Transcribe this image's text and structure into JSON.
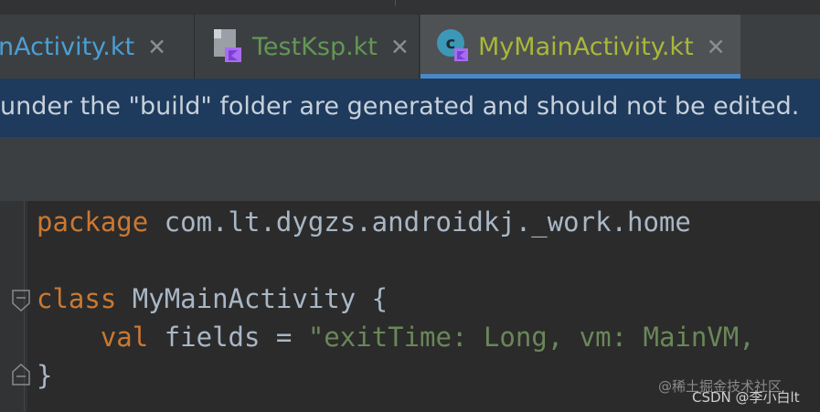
{
  "tabs": [
    {
      "label": "ainActivity.kt",
      "icon": "kotlin-file-icon"
    },
    {
      "label": "TestKsp.kt",
      "icon": "kotlin-script-file-icon"
    },
    {
      "label": "MyMainActivity.kt",
      "icon": "kotlin-class-icon",
      "active": true
    }
  ],
  "close_glyph": "✕",
  "banner": {
    "text": "under the \"build\" folder are generated and should not be edited."
  },
  "code": {
    "line1": {
      "keyword": "package",
      "rest": " com.lt.dygzs.androidkj._work.home"
    },
    "line3": {
      "keyword": "class",
      "rest": " MyMainActivity {"
    },
    "line4": {
      "indent": "    ",
      "keyword": "val",
      "rest": " fields = ",
      "string": "\"exitTime: Long, vm: MainVM,"
    },
    "line5": {
      "text": "}"
    }
  },
  "watermark": {
    "line1": "@稀土掘金技术社区",
    "line2": "CSDN @李小白lt"
  },
  "colors": {
    "keyword": "#cc7832",
    "string": "#6a8759",
    "text": "#a9b7c6",
    "banner_bg": "#1e3a5c",
    "active_tab_underline": "#4a88c7"
  }
}
